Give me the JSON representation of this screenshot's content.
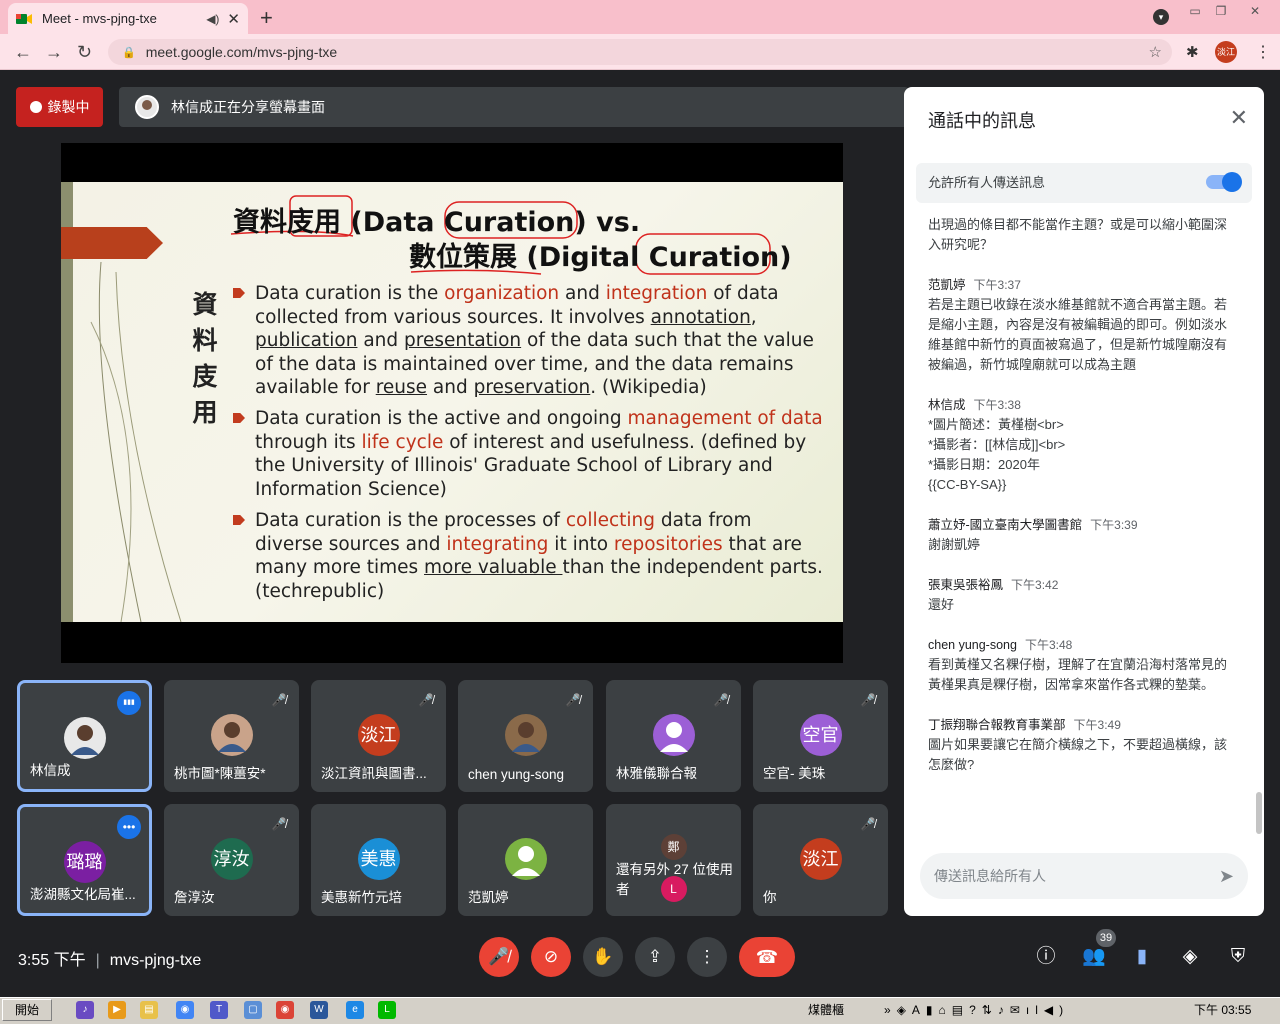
{
  "browser": {
    "tab_title": "Meet - mvs-pjng-txe",
    "new_tab_glyph": "+",
    "url": "meet.google.com/mvs-pjng-txe",
    "profile_label": "淡江"
  },
  "meet": {
    "recording_label": "錄製中",
    "presenter_text": "林信成正在分享螢幕畫面",
    "meeting_time": "3:55 下午",
    "meeting_code": "mvs-pjng-txe",
    "participant_count": "39"
  },
  "slide": {
    "vertical_title": [
      "資",
      "料",
      "庋",
      "用"
    ],
    "title_line1_cn": "資料庋用",
    "title_line1_en": " (Data Curation) vs.",
    "title_line2_cn": "數位策展",
    "title_line2_en": " (Digital Curation)",
    "bullets": [
      {
        "segments": [
          {
            "t": "Data curation is the "
          },
          {
            "t": "organization",
            "s": "red"
          },
          {
            "t": " and "
          },
          {
            "t": "integration",
            "s": "red"
          },
          {
            "t": " of data collected from various sources. It involves "
          },
          {
            "t": "annotation",
            "s": "u"
          },
          {
            "t": ", "
          },
          {
            "t": "publication",
            "s": "u"
          },
          {
            "t": " and "
          },
          {
            "t": "presentation",
            "s": "u"
          },
          {
            "t": " of the data such that the value of the data is maintained over time, and the data remains available for "
          },
          {
            "t": "reuse",
            "s": "u"
          },
          {
            "t": " and "
          },
          {
            "t": "preservation",
            "s": "u"
          },
          {
            "t": ". (Wikipedia)"
          }
        ]
      },
      {
        "segments": [
          {
            "t": "Data curation is the active and ongoing "
          },
          {
            "t": "management of data",
            "s": "red"
          },
          {
            "t": " through its "
          },
          {
            "t": "life cycle",
            "s": "red"
          },
          {
            "t": " of interest and usefulness. (defined by the University of Illinois' Graduate School of Library and Information Science)"
          }
        ]
      },
      {
        "segments": [
          {
            "t": "Data curation is the processes of "
          },
          {
            "t": "collecting",
            "s": "red"
          },
          {
            "t": " data from diverse sources and "
          },
          {
            "t": "integrating",
            "s": "red"
          },
          {
            "t": " it into "
          },
          {
            "t": "repositories",
            "s": "red"
          },
          {
            "t": " that are many more times "
          },
          {
            "t": "more valuable ",
            "s": "u"
          },
          {
            "t": "than the independent parts. (techrepublic)"
          }
        ]
      }
    ]
  },
  "tiles": [
    {
      "name": "林信成",
      "avatar": "photo",
      "color": "#e8e8e8",
      "status": "speaking",
      "highlight": true
    },
    {
      "name": "桃市圖*陳薑安*",
      "avatar": "photo",
      "color": "#c9a38a",
      "status": "muted"
    },
    {
      "name": "淡江資訊與圖書...",
      "avatar": "淡江",
      "color": "#c43d1e",
      "status": "muted"
    },
    {
      "name": "chen yung-song",
      "avatar": "photo",
      "color": "#8a6a4a",
      "status": "muted"
    },
    {
      "name": "林雅儀聯合報",
      "avatar": "person",
      "color": "#9c5fd6",
      "status": "muted"
    },
    {
      "name": "空官- 美珠",
      "avatar": "空官",
      "color": "#9c5fd6",
      "status": "muted"
    },
    {
      "name": "澎湖縣文化局崔...",
      "avatar": "璐璐",
      "color": "#7b1fa2",
      "status": "more",
      "highlight": true
    },
    {
      "name": "詹淳汝",
      "avatar": "淳汝",
      "color": "#1e6b4f",
      "status": "muted"
    },
    {
      "name": "美惠新竹元培",
      "avatar": "美惠",
      "color": "#1a8fd6",
      "status": "none"
    },
    {
      "name": "范凱婷",
      "avatar": "person",
      "color": "#7cb342",
      "status": "none"
    },
    {
      "name": "還有另外 27 位使用者",
      "avatar": "group",
      "color": "#5d4037",
      "status": "none",
      "mini": [
        "鄭",
        "L"
      ]
    },
    {
      "name": "你",
      "avatar": "淡江",
      "color": "#c43d1e",
      "status": "muted"
    }
  ],
  "chat": {
    "title": "通話中的訊息",
    "allow_label": "允許所有人傳送訊息",
    "input_placeholder": "傳送訊息給所有人",
    "messages": [
      {
        "sender": "",
        "time": "",
        "text": "出現過的條目都不能當作主題？或是可以縮小範圍深入研究呢？"
      },
      {
        "sender": "范凱婷",
        "time": "下午3:37",
        "text": "若是主題已收錄在淡水維基館就不適合再當主題。若是縮小主題，內容是沒有被編輯過的即可。例如淡水維基館中新竹的頁面被寫過了，但是新竹城隍廟沒有被編過，新竹城隍廟就可以成為主題"
      },
      {
        "sender": "林信成",
        "time": "下午3:38",
        "text": "*圖片簡述：黃槿樹<br>\n*攝影者：[[林信成]]<br>\n*攝影日期：2020年\n{{CC-BY-SA}}"
      },
      {
        "sender": "蕭立妤-國立臺南大學圖書館",
        "time": "下午3:39",
        "text": "謝謝凱婷"
      },
      {
        "sender": "張東吳張裕鳳",
        "time": "下午3:42",
        "text": "還好"
      },
      {
        "sender": "chen yung-song",
        "time": "下午3:48",
        "text": "看到黃槿又名粿仔樹，理解了在宜蘭沿海村落常見的黃槿果真是粿仔樹，因常拿來當作各式粿的墊葉。"
      },
      {
        "sender": "丁振翔聯合報教育事業部",
        "time": "下午3:49",
        "text": "圖片如果要讓它在簡介橫線之下，不要超過橫線，該怎麼做?"
      }
    ]
  },
  "taskbar": {
    "start_label": "開始",
    "ime_label": "煤體櫃",
    "clock": "下午 03:55"
  },
  "icons": {
    "mic_off": "mic-off-icon",
    "camera_off": "camera-off-icon",
    "hand": "raise-hand-icon",
    "present": "present-icon",
    "more": "more-options-icon",
    "hangup": "hangup-icon",
    "info": "info-icon",
    "people": "people-icon",
    "chat": "chat-icon",
    "activities": "activities-icon",
    "safety": "host-controls-icon"
  }
}
